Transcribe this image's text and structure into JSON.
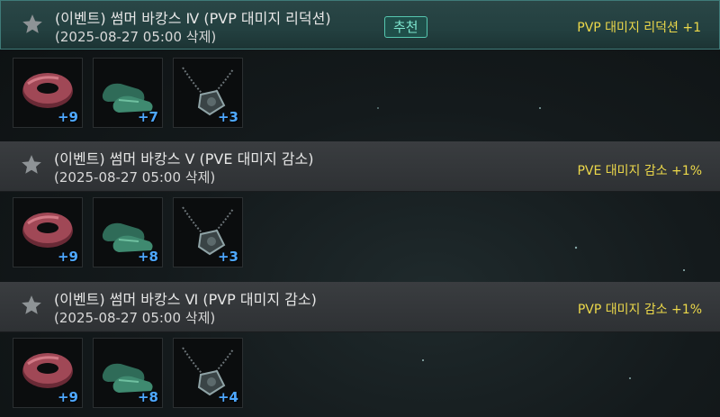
{
  "sets": [
    {
      "title": "(이벤트) 썸머 바캉스 Ⅳ (PVP 대미지 리덕션)",
      "expiry": "(2025-08-27 05:00 삭제)",
      "badge": "추천",
      "effect": "PVP 대미지 리덕션 +1",
      "selected": true,
      "items": [
        {
          "icon": "swim-ring-icon",
          "count": "+9"
        },
        {
          "icon": "green-shoes-icon",
          "count": "+7"
        },
        {
          "icon": "dog-tag-necklace-icon",
          "count": "+3"
        }
      ]
    },
    {
      "title": "(이벤트) 썸머 바캉스 Ⅴ (PVE 대미지 감소)",
      "expiry": "(2025-08-27 05:00 삭제)",
      "effect": "PVE 대미지 감소 +1%",
      "selected": false,
      "items": [
        {
          "icon": "swim-ring-icon",
          "count": "+9"
        },
        {
          "icon": "green-shoes-icon",
          "count": "+8"
        },
        {
          "icon": "dog-tag-necklace-icon",
          "count": "+3"
        }
      ]
    },
    {
      "title": "(이벤트) 썸머 바캉스 Ⅵ (PVP 대미지 감소)",
      "expiry": "(2025-08-27 05:00 삭제)",
      "effect": "PVP 대미지 감소 +1%",
      "selected": false,
      "items": [
        {
          "icon": "swim-ring-icon",
          "count": "+9"
        },
        {
          "icon": "green-shoes-icon",
          "count": "+8"
        },
        {
          "icon": "dog-tag-necklace-icon",
          "count": "+4"
        }
      ]
    }
  ],
  "colors": {
    "effect_text": "#ecd84a",
    "count_text": "#4ea8ff",
    "badge_border": "#56c7b0"
  }
}
